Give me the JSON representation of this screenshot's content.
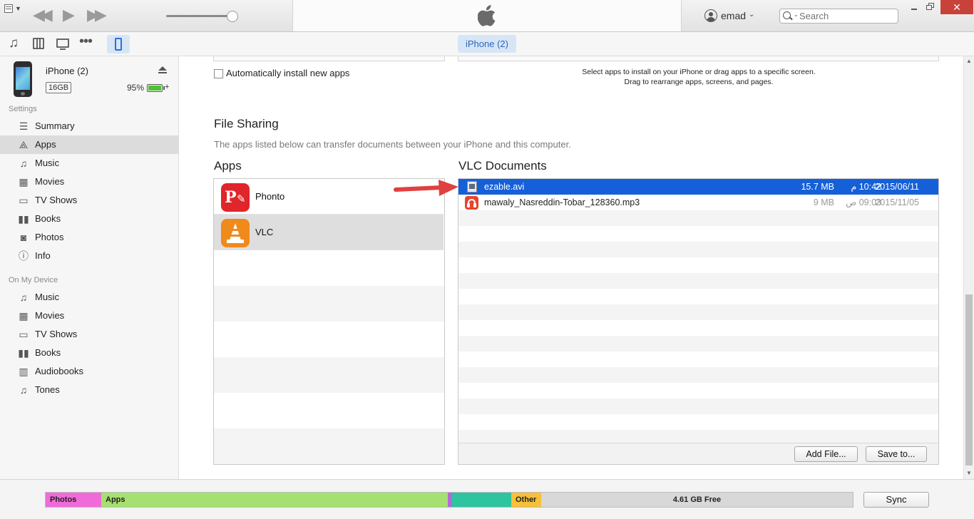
{
  "toolbar": {
    "user_name": "emad",
    "search_placeholder": "Search",
    "device_tab_label": "iPhone (2)"
  },
  "device": {
    "name": "iPhone (2)",
    "capacity": "16GB",
    "battery": "95%"
  },
  "sidebar": {
    "settings_header": "Settings",
    "settings_items": [
      {
        "label": "Summary",
        "icon": "summary-icon"
      },
      {
        "label": "Apps",
        "icon": "apps-icon"
      },
      {
        "label": "Music",
        "icon": "music-note-icon"
      },
      {
        "label": "Movies",
        "icon": "film-icon"
      },
      {
        "label": "TV Shows",
        "icon": "tv-icon"
      },
      {
        "label": "Books",
        "icon": "book-icon"
      },
      {
        "label": "Photos",
        "icon": "camera-icon"
      },
      {
        "label": "Info",
        "icon": "info-icon"
      }
    ],
    "device_header": "On My Device",
    "device_items": [
      {
        "label": "Music",
        "icon": "music-note-icon"
      },
      {
        "label": "Movies",
        "icon": "film-icon"
      },
      {
        "label": "TV Shows",
        "icon": "tv-icon"
      },
      {
        "label": "Books",
        "icon": "book-icon"
      },
      {
        "label": "Audiobooks",
        "icon": "audiobook-icon"
      },
      {
        "label": "Tones",
        "icon": "bell-icon"
      }
    ]
  },
  "apps_section": {
    "auto_install_label": "Automatically install new apps",
    "hint_line1": "Select apps to install on your iPhone or drag apps to a specific screen.",
    "hint_line2": "Drag to rearrange apps, screens, and pages."
  },
  "file_sharing": {
    "title": "File Sharing",
    "description": "The apps listed below can transfer documents between your iPhone and this computer.",
    "apps_header": "Apps",
    "apps": [
      {
        "name": "Phonto",
        "color": "#e0252b"
      },
      {
        "name": "VLC",
        "color": "#f08a1c"
      }
    ],
    "docs_header": "VLC Documents",
    "documents": [
      {
        "name": "ezable.avi",
        "size": "15.7 MB",
        "time": "10:42 م",
        "date": "2015/06/11",
        "selected": true
      },
      {
        "name": "mawaly_Nasreddin-Tobar_128360.mp3",
        "size": "9 MB",
        "time": "09:03 ص",
        "date": "2015/11/05",
        "selected": false
      }
    ],
    "add_file_label": "Add File...",
    "save_to_label": "Save to..."
  },
  "storage": {
    "segments": [
      {
        "label": "Photos",
        "color": "#f06bd8"
      },
      {
        "label": "Apps",
        "color": "#a6e070"
      },
      {
        "label": "",
        "color": "#2fc4a0"
      },
      {
        "label": "Other",
        "color": "#f6c03a"
      }
    ],
    "free_label": "4.61 GB Free",
    "sync_label": "Sync"
  },
  "colors": {
    "selection": "#1560d8",
    "accent_tab": "#d6e6f7",
    "arrow": "#e04040"
  }
}
